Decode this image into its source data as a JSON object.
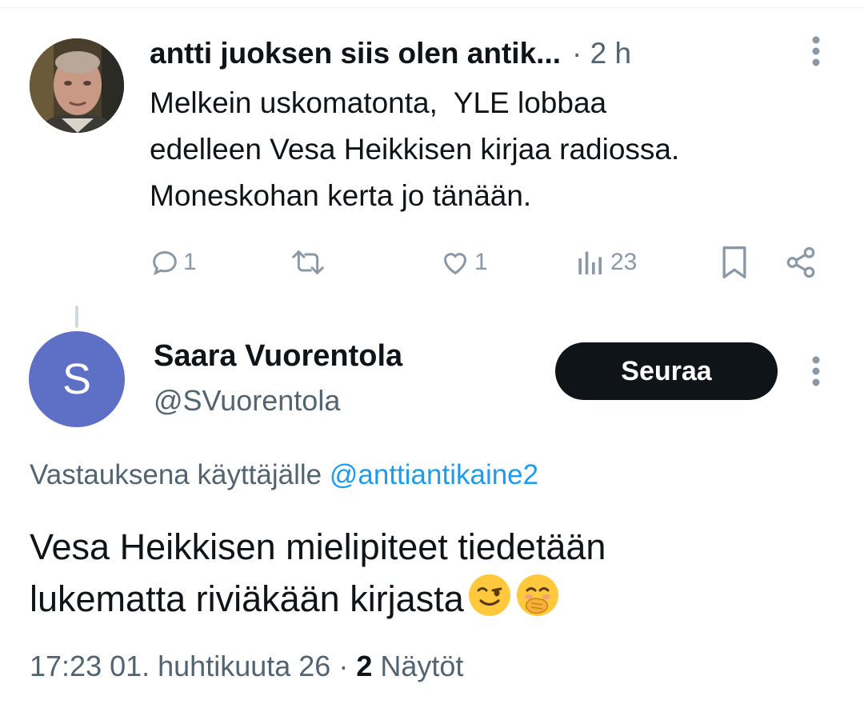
{
  "parent_tweet": {
    "author_name": "antti juoksen siis olen antik...",
    "time": "· 2 h",
    "text_lines": [
      "Melkein uskomatonta,  YLE lobbaa",
      "edelleen Vesa Heikkisen kirjaa radiossa.",
      "Moneskohan kerta jo tänään."
    ],
    "actions": {
      "reply_count": "1",
      "retweet_count": "",
      "like_count": "1",
      "views_count": "23"
    }
  },
  "reply_tweet": {
    "avatar_letter": "S",
    "avatar_color": "#5e6fc6",
    "author_name": "Saara Vuorentola",
    "handle": "@SVuorentola",
    "follow_label": "Seuraa",
    "reply_to_prefix": "Vastauksena käyttäjälle",
    "reply_to_handle": "@anttiantikaine2",
    "text_lines": [
      "Vesa Heikkisen mielipiteet tiedetään",
      "lukematta riviäkään kirjasta"
    ],
    "emojis": [
      "winking-face",
      "face-with-hand-over-mouth"
    ],
    "timestamp": "17:23 01. huhtikuuta 26",
    "separator": " · ",
    "views_count": "2",
    "views_label": " Näytöt"
  },
  "colors": {
    "text_primary": "#0f1419",
    "text_secondary": "#536471",
    "icon_gray": "#8b98a5",
    "link_blue": "#1d9bf0",
    "follow_bg": "#0f1419"
  }
}
